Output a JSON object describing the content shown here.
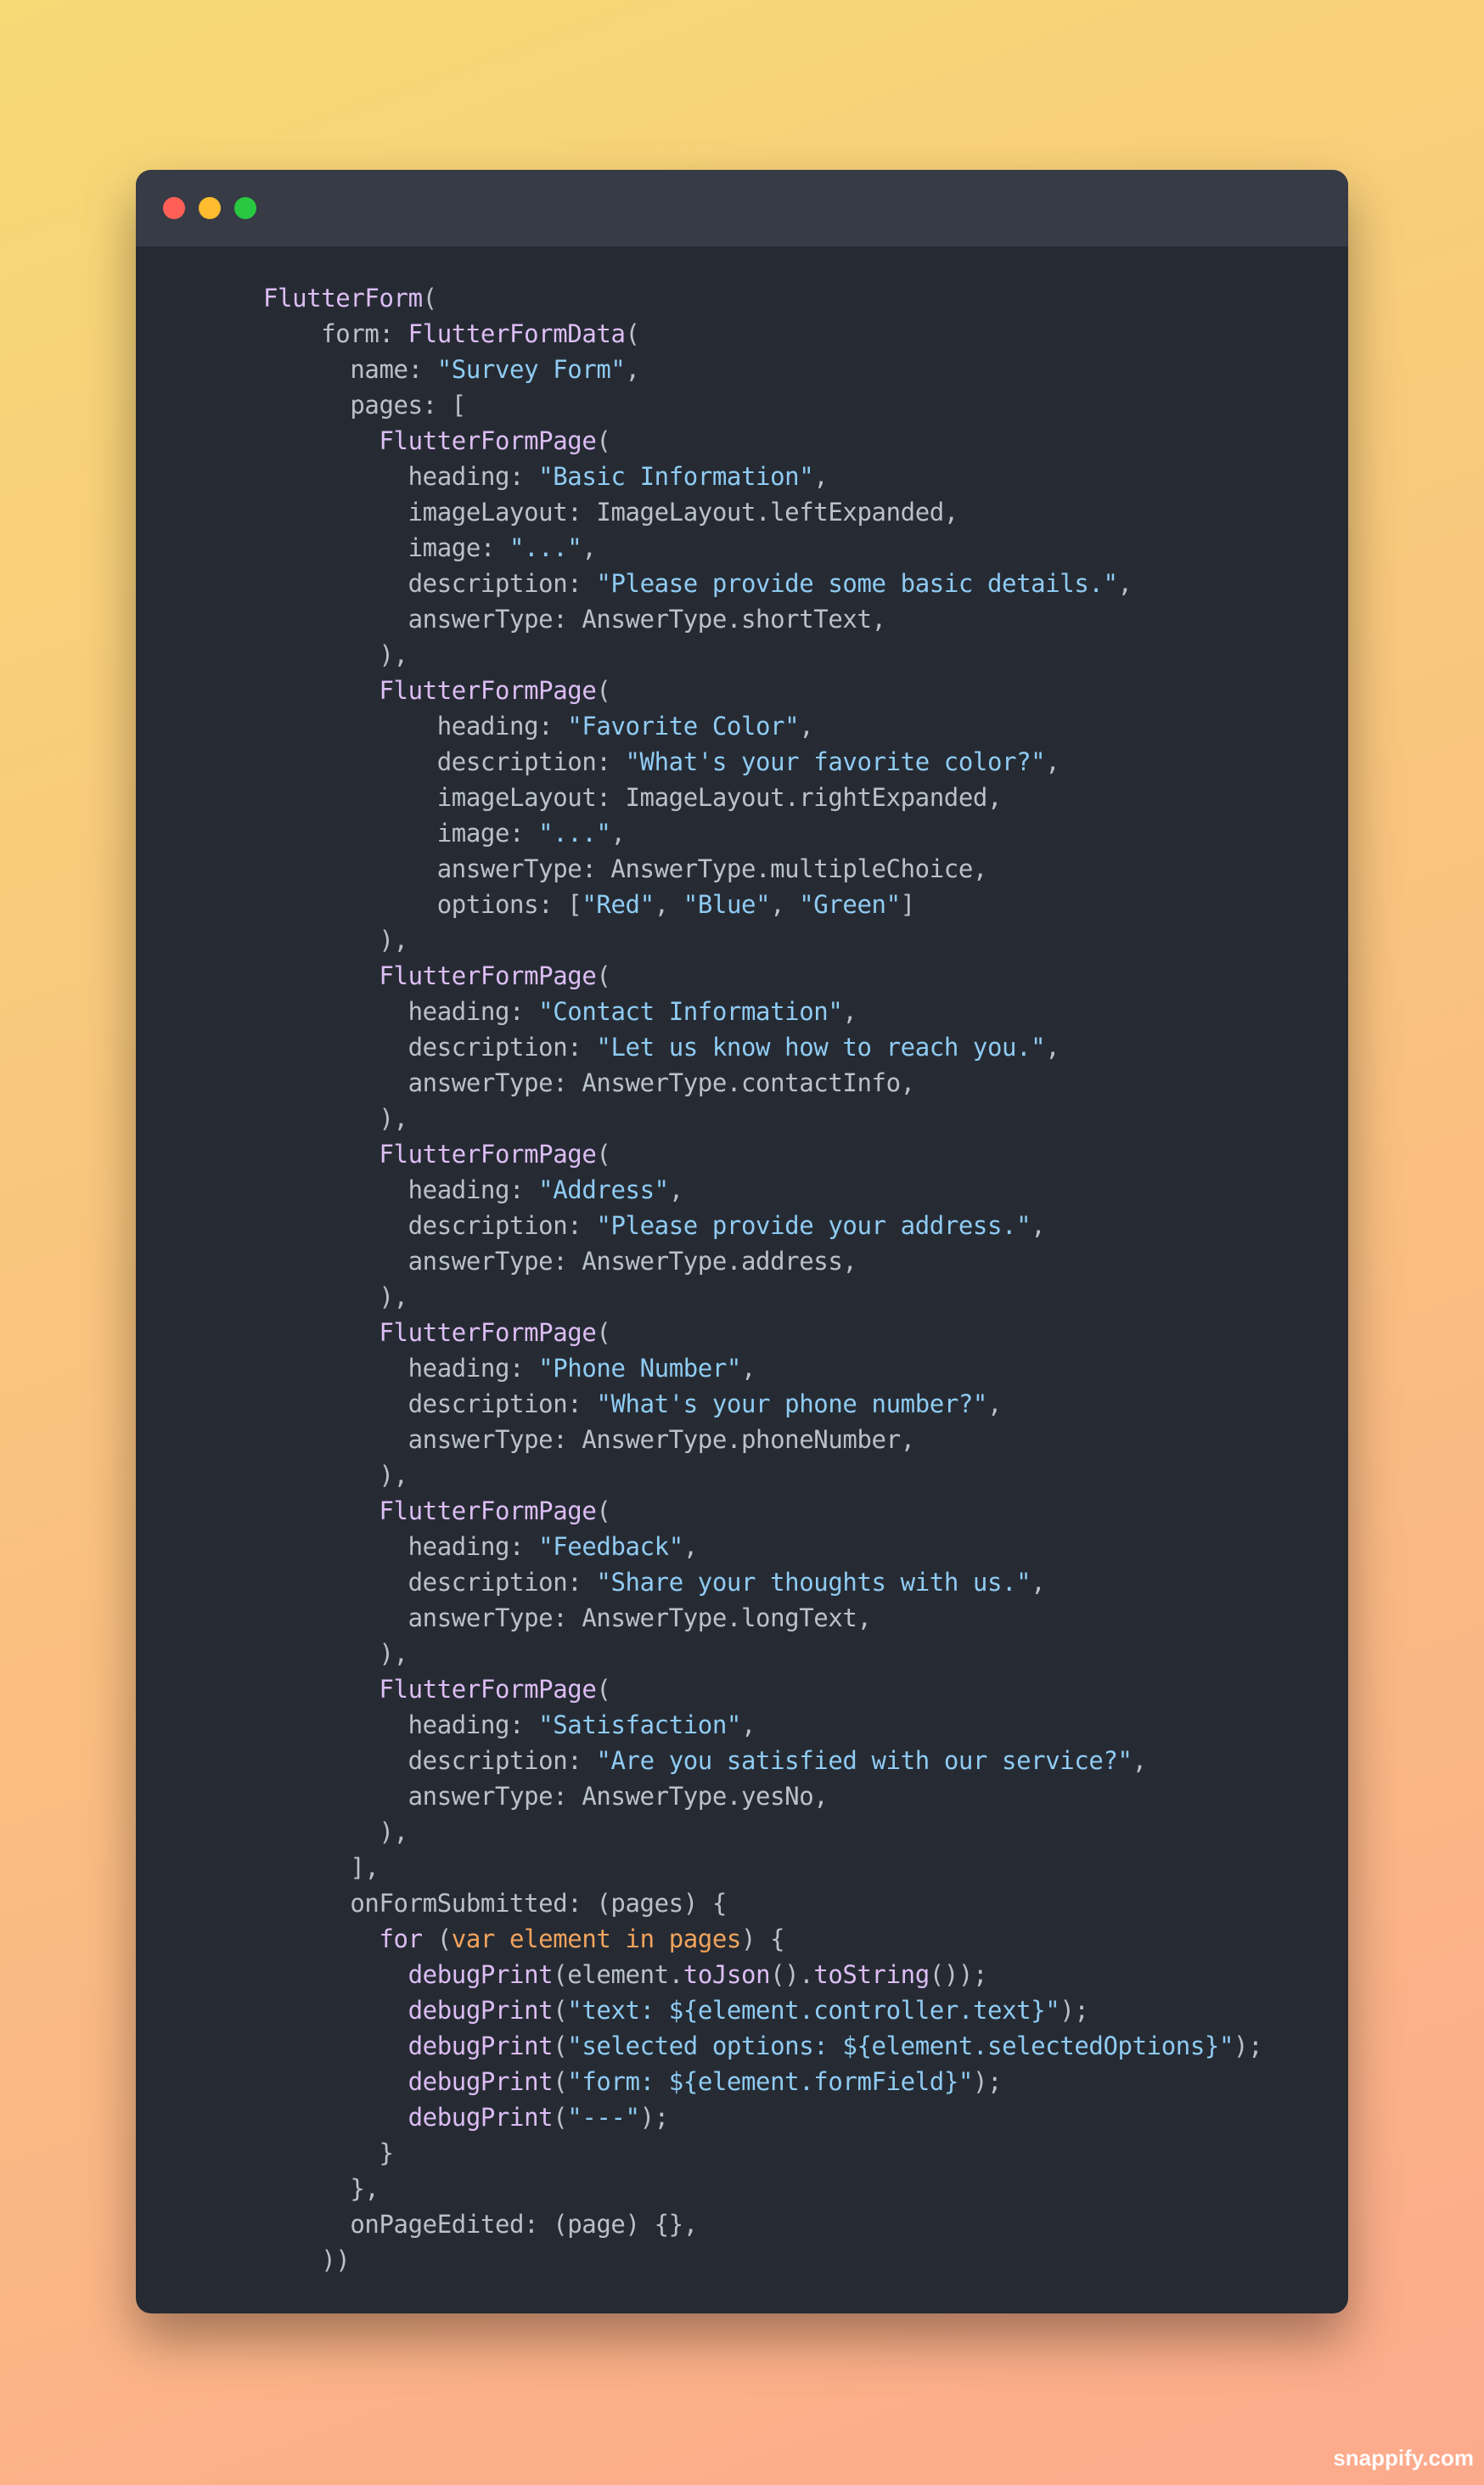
{
  "window": {
    "controls": [
      {
        "name": "close",
        "color": "#ff5f57"
      },
      {
        "name": "minimize",
        "color": "#febc2e"
      },
      {
        "name": "maximize",
        "color": "#28c840"
      }
    ]
  },
  "watermark": "snappify.com",
  "code": [
    {
      "i": 0,
      "t": [
        [
          "f",
          "FlutterForm"
        ],
        [
          "p",
          "("
        ]
      ]
    },
    {
      "i": 4,
      "t": [
        [
          "p",
          "form: "
        ],
        [
          "f",
          "FlutterFormData"
        ],
        [
          "p",
          "("
        ]
      ]
    },
    {
      "i": 6,
      "t": [
        [
          "p",
          "name: "
        ],
        [
          "s",
          "\"Survey Form\""
        ],
        [
          "p",
          ","
        ]
      ]
    },
    {
      "i": 6,
      "t": [
        [
          "p",
          "pages: ["
        ]
      ]
    },
    {
      "i": 8,
      "t": [
        [
          "f",
          "FlutterFormPage"
        ],
        [
          "p",
          "("
        ]
      ]
    },
    {
      "i": 10,
      "t": [
        [
          "p",
          "heading: "
        ],
        [
          "s",
          "\"Basic Information\""
        ],
        [
          "p",
          ","
        ]
      ]
    },
    {
      "i": 10,
      "t": [
        [
          "p",
          "imageLayout: ImageLayout.leftExpanded,"
        ]
      ]
    },
    {
      "i": 10,
      "t": [
        [
          "p",
          "image: "
        ],
        [
          "s",
          "\"...\""
        ],
        [
          "p",
          ","
        ]
      ]
    },
    {
      "i": 10,
      "t": [
        [
          "p",
          "description: "
        ],
        [
          "s",
          "\"Please provide some basic details.\""
        ],
        [
          "p",
          ","
        ]
      ]
    },
    {
      "i": 10,
      "t": [
        [
          "p",
          "answerType: AnswerType.shortText,"
        ]
      ]
    },
    {
      "i": 8,
      "t": [
        [
          "p",
          "),"
        ]
      ]
    },
    {
      "i": 8,
      "t": [
        [
          "f",
          "FlutterFormPage"
        ],
        [
          "p",
          "("
        ]
      ]
    },
    {
      "i": 12,
      "t": [
        [
          "p",
          "heading: "
        ],
        [
          "s",
          "\"Favorite Color\""
        ],
        [
          "p",
          ","
        ]
      ]
    },
    {
      "i": 12,
      "t": [
        [
          "p",
          "description: "
        ],
        [
          "s",
          "\"What's your favorite color?\""
        ],
        [
          "p",
          ","
        ]
      ]
    },
    {
      "i": 12,
      "t": [
        [
          "p",
          "imageLayout: ImageLayout.rightExpanded,"
        ]
      ]
    },
    {
      "i": 12,
      "t": [
        [
          "p",
          "image: "
        ],
        [
          "s",
          "\"...\""
        ],
        [
          "p",
          ","
        ]
      ]
    },
    {
      "i": 12,
      "t": [
        [
          "p",
          "answerType: AnswerType.multipleChoice,"
        ]
      ]
    },
    {
      "i": 12,
      "t": [
        [
          "p",
          "options: ["
        ],
        [
          "s",
          "\"Red\""
        ],
        [
          "p",
          ", "
        ],
        [
          "s",
          "\"Blue\""
        ],
        [
          "p",
          ", "
        ],
        [
          "s",
          "\"Green\""
        ],
        [
          "p",
          "]"
        ]
      ]
    },
    {
      "i": 8,
      "t": [
        [
          "p",
          "),"
        ]
      ]
    },
    {
      "i": 8,
      "t": [
        [
          "f",
          "FlutterFormPage"
        ],
        [
          "p",
          "("
        ]
      ]
    },
    {
      "i": 10,
      "t": [
        [
          "p",
          "heading: "
        ],
        [
          "s",
          "\"Contact Information\""
        ],
        [
          "p",
          ","
        ]
      ]
    },
    {
      "i": 10,
      "t": [
        [
          "p",
          "description: "
        ],
        [
          "s",
          "\"Let us know how to reach you.\""
        ],
        [
          "p",
          ","
        ]
      ]
    },
    {
      "i": 10,
      "t": [
        [
          "p",
          "answerType: AnswerType.contactInfo,"
        ]
      ]
    },
    {
      "i": 8,
      "t": [
        [
          "p",
          "),"
        ]
      ]
    },
    {
      "i": 8,
      "t": [
        [
          "f",
          "FlutterFormPage"
        ],
        [
          "p",
          "("
        ]
      ]
    },
    {
      "i": 10,
      "t": [
        [
          "p",
          "heading: "
        ],
        [
          "s",
          "\"Address\""
        ],
        [
          "p",
          ","
        ]
      ]
    },
    {
      "i": 10,
      "t": [
        [
          "p",
          "description: "
        ],
        [
          "s",
          "\"Please provide your address.\""
        ],
        [
          "p",
          ","
        ]
      ]
    },
    {
      "i": 10,
      "t": [
        [
          "p",
          "answerType: AnswerType.address,"
        ]
      ]
    },
    {
      "i": 8,
      "t": [
        [
          "p",
          "),"
        ]
      ]
    },
    {
      "i": 8,
      "t": [
        [
          "f",
          "FlutterFormPage"
        ],
        [
          "p",
          "("
        ]
      ]
    },
    {
      "i": 10,
      "t": [
        [
          "p",
          "heading: "
        ],
        [
          "s",
          "\"Phone Number\""
        ],
        [
          "p",
          ","
        ]
      ]
    },
    {
      "i": 10,
      "t": [
        [
          "p",
          "description: "
        ],
        [
          "s",
          "\"What's your phone number?\""
        ],
        [
          "p",
          ","
        ]
      ]
    },
    {
      "i": 10,
      "t": [
        [
          "p",
          "answerType: AnswerType.phoneNumber,"
        ]
      ]
    },
    {
      "i": 8,
      "t": [
        [
          "p",
          "),"
        ]
      ]
    },
    {
      "i": 8,
      "t": [
        [
          "f",
          "FlutterFormPage"
        ],
        [
          "p",
          "("
        ]
      ]
    },
    {
      "i": 10,
      "t": [
        [
          "p",
          "heading: "
        ],
        [
          "s",
          "\"Feedback\""
        ],
        [
          "p",
          ","
        ]
      ]
    },
    {
      "i": 10,
      "t": [
        [
          "p",
          "description: "
        ],
        [
          "s",
          "\"Share your thoughts with us.\""
        ],
        [
          "p",
          ","
        ]
      ]
    },
    {
      "i": 10,
      "t": [
        [
          "p",
          "answerType: AnswerType.longText,"
        ]
      ]
    },
    {
      "i": 8,
      "t": [
        [
          "p",
          "),"
        ]
      ]
    },
    {
      "i": 8,
      "t": [
        [
          "f",
          "FlutterFormPage"
        ],
        [
          "p",
          "("
        ]
      ]
    },
    {
      "i": 10,
      "t": [
        [
          "p",
          "heading: "
        ],
        [
          "s",
          "\"Satisfaction\""
        ],
        [
          "p",
          ","
        ]
      ]
    },
    {
      "i": 10,
      "t": [
        [
          "p",
          "description: "
        ],
        [
          "s",
          "\"Are you satisfied with our service?\""
        ],
        [
          "p",
          ","
        ]
      ]
    },
    {
      "i": 10,
      "t": [
        [
          "p",
          "answerType: AnswerType.yesNo,"
        ]
      ]
    },
    {
      "i": 8,
      "t": [
        [
          "p",
          "),"
        ]
      ]
    },
    {
      "i": 6,
      "t": [
        [
          "p",
          "],"
        ]
      ]
    },
    {
      "i": 6,
      "t": [
        [
          "p",
          "onFormSubmitted: (pages) {"
        ]
      ]
    },
    {
      "i": 8,
      "t": [
        [
          "f",
          "for"
        ],
        [
          "p",
          " ("
        ],
        [
          "k",
          "var element in pages"
        ],
        [
          "p",
          ") {"
        ]
      ]
    },
    {
      "i": 10,
      "t": [
        [
          "f",
          "debugPrint"
        ],
        [
          "p",
          "(element."
        ],
        [
          "f",
          "toJson"
        ],
        [
          "p",
          "()."
        ],
        [
          "f",
          "toString"
        ],
        [
          "p",
          "());"
        ]
      ]
    },
    {
      "i": 10,
      "t": [
        [
          "f",
          "debugPrint"
        ],
        [
          "p",
          "("
        ],
        [
          "s",
          "\"text: ${element.controller.text}\""
        ],
        [
          "p",
          ");"
        ]
      ]
    },
    {
      "i": 10,
      "t": [
        [
          "f",
          "debugPrint"
        ],
        [
          "p",
          "("
        ],
        [
          "s",
          "\"selected options: ${element.selectedOptions}\""
        ],
        [
          "p",
          ");"
        ]
      ]
    },
    {
      "i": 10,
      "t": [
        [
          "f",
          "debugPrint"
        ],
        [
          "p",
          "("
        ],
        [
          "s",
          "\"form: ${element.formField}\""
        ],
        [
          "p",
          ");"
        ]
      ]
    },
    {
      "i": 10,
      "t": [
        [
          "f",
          "debugPrint"
        ],
        [
          "p",
          "("
        ],
        [
          "s",
          "\"---\""
        ],
        [
          "p",
          ");"
        ]
      ]
    },
    {
      "i": 8,
      "t": [
        [
          "p",
          "}"
        ]
      ]
    },
    {
      "i": 6,
      "t": [
        [
          "p",
          "},"
        ]
      ]
    },
    {
      "i": 6,
      "t": [
        [
          "p",
          "onPageEdited: (page) {},"
        ]
      ]
    },
    {
      "i": 4,
      "t": [
        [
          "p",
          "))"
        ]
      ]
    }
  ]
}
